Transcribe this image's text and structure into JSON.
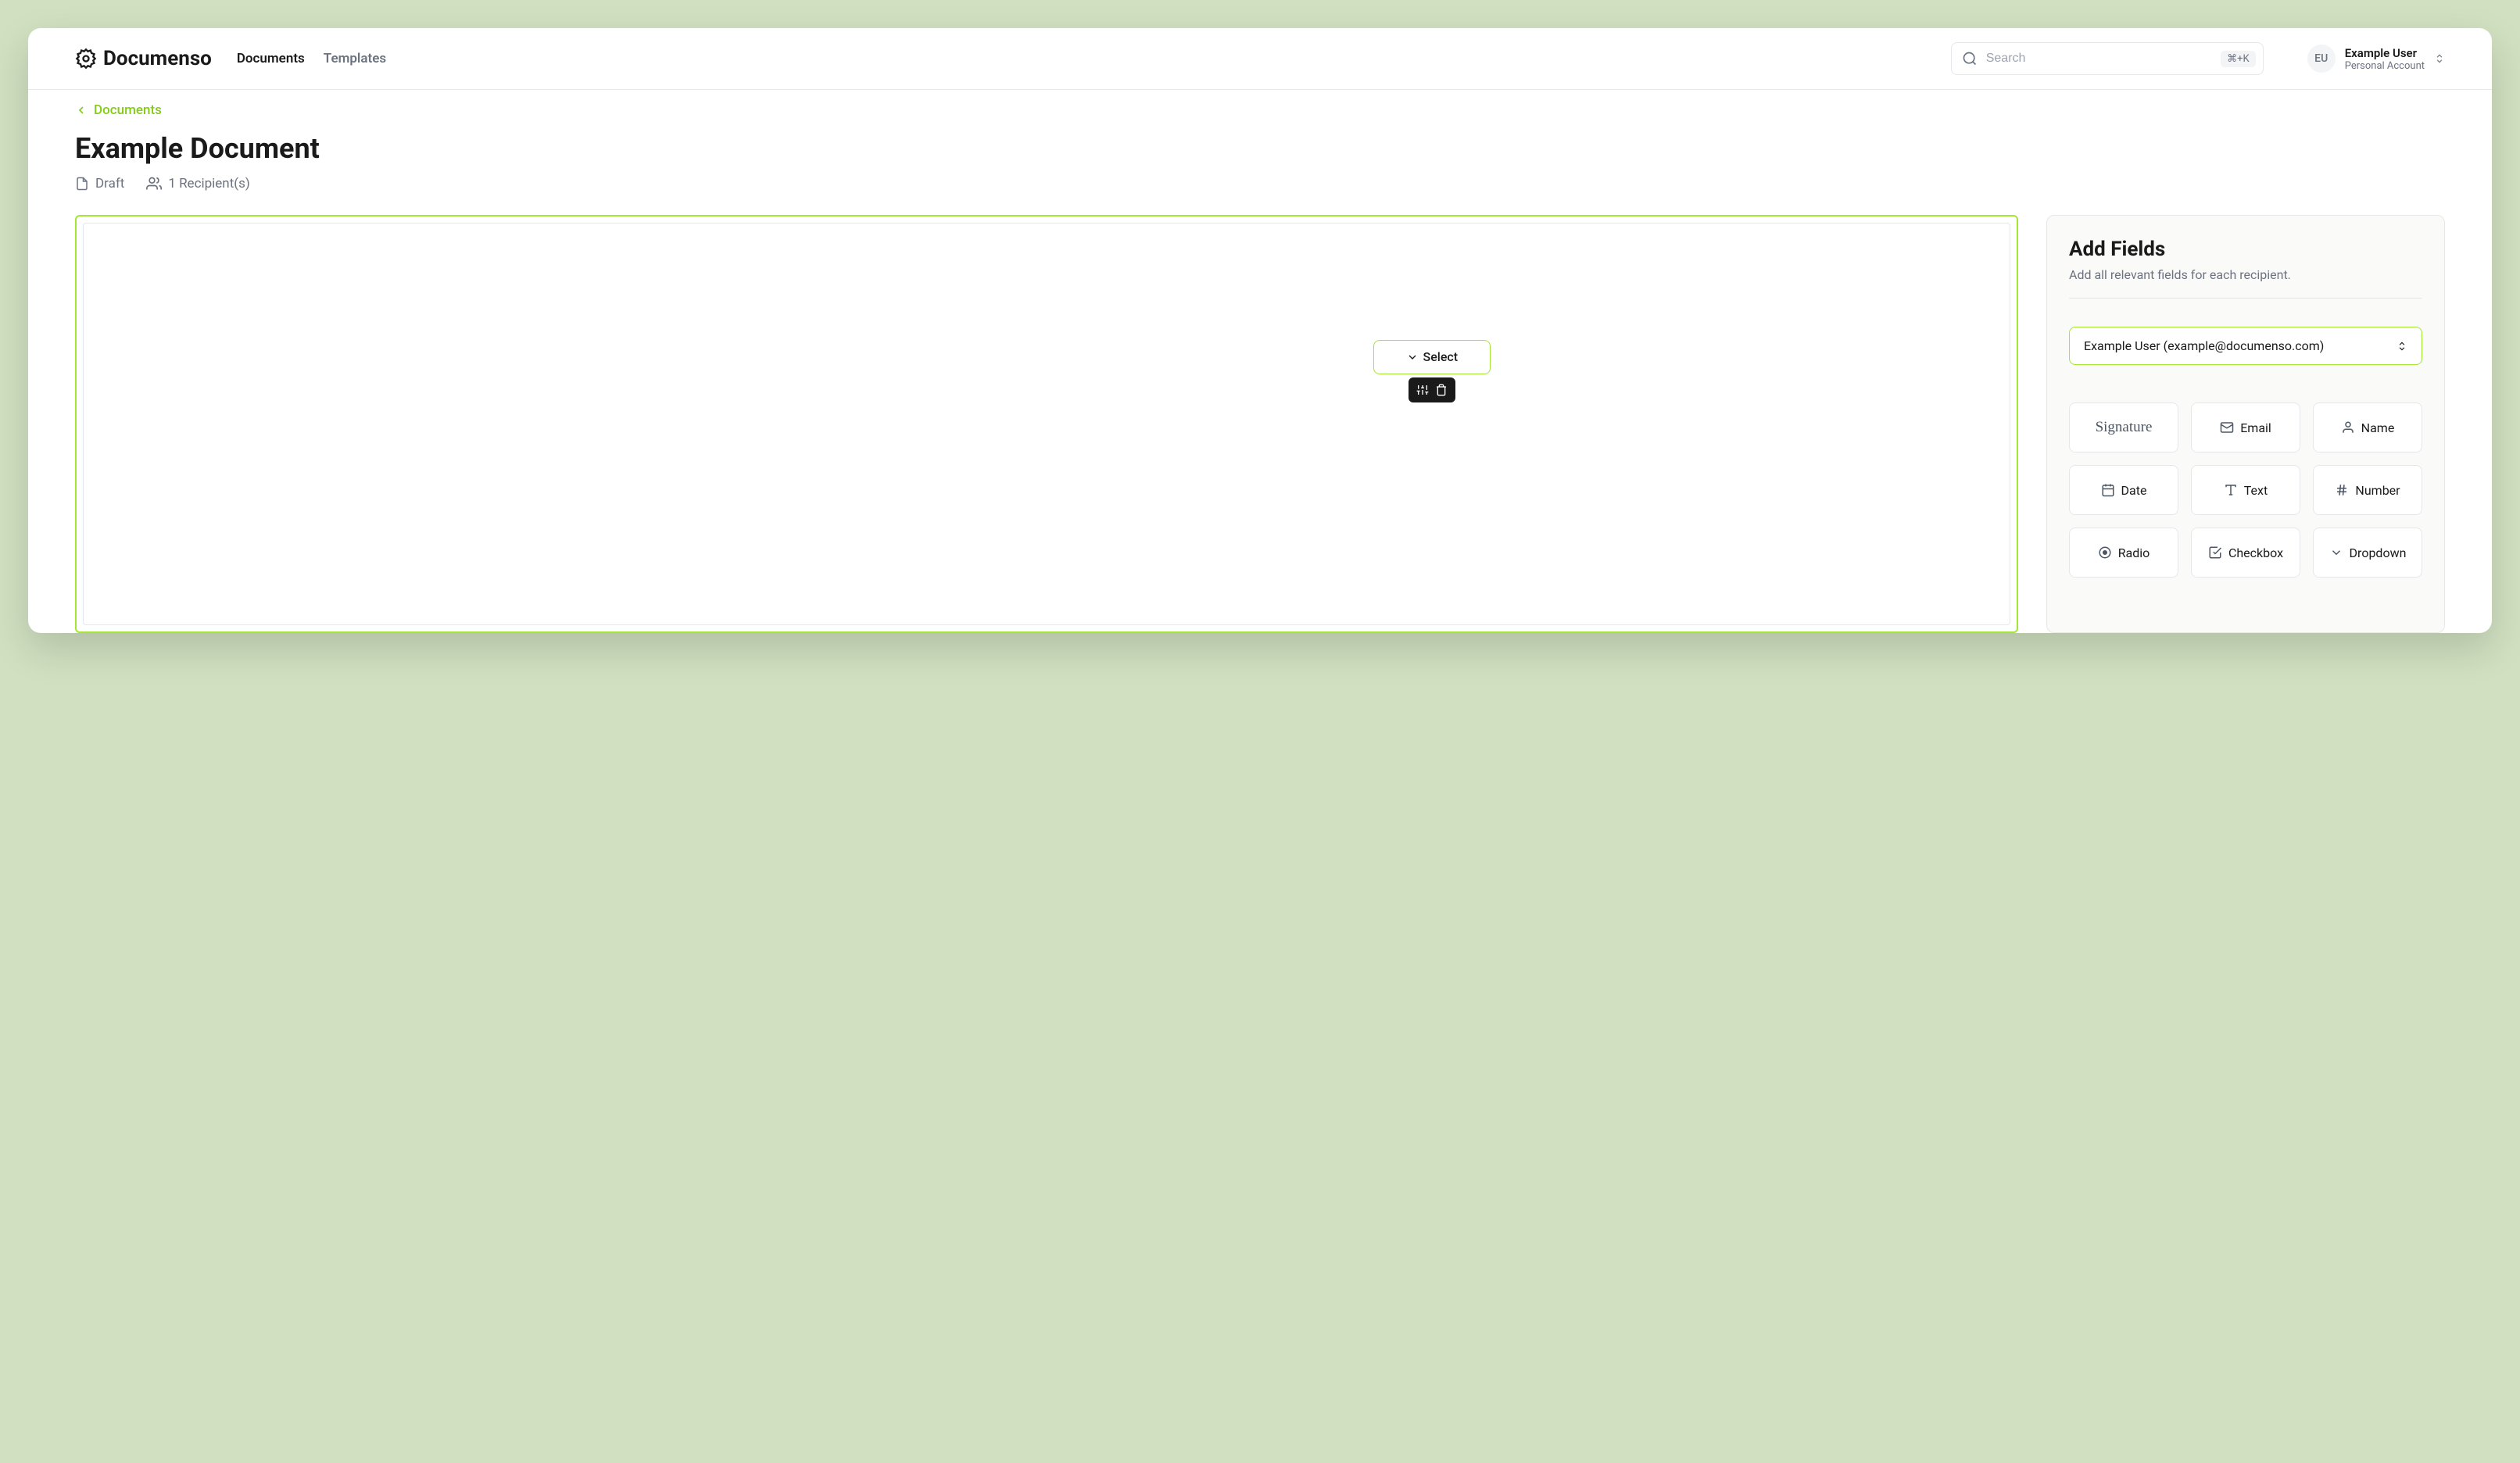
{
  "brand": "Documenso",
  "nav": {
    "documents": "Documents",
    "templates": "Templates"
  },
  "search": {
    "placeholder": "Search",
    "shortcut": "⌘+K"
  },
  "account": {
    "initials": "EU",
    "name": "Example User",
    "type": "Personal Account"
  },
  "breadcrumb": "Documents",
  "page": {
    "title": "Example Document",
    "status": "Draft",
    "recipients": "1 Recipient(s)"
  },
  "canvas": {
    "field_label": "Select"
  },
  "sidebar": {
    "title": "Add Fields",
    "subtitle": "Add all relevant fields for each recipient.",
    "recipient": "Example User (example@documenso.com)",
    "fields": {
      "signature": "Signature",
      "email": "Email",
      "name": "Name",
      "date": "Date",
      "text": "Text",
      "number": "Number",
      "radio": "Radio",
      "checkbox": "Checkbox",
      "dropdown": "Dropdown"
    }
  }
}
